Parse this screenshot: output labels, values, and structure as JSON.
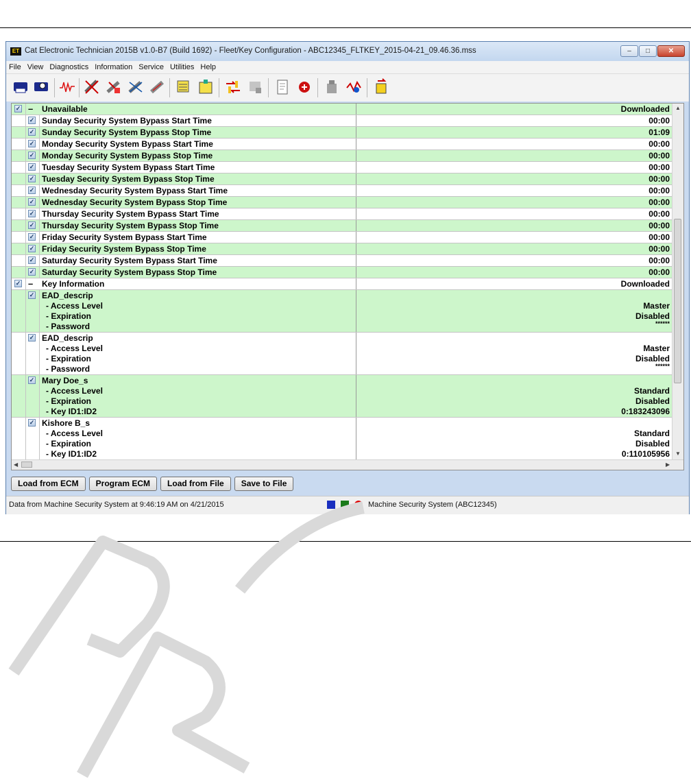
{
  "window": {
    "app_icon_text": "ET",
    "title": "Cat Electronic Technician 2015B v1.0-B7 (Build 1692) - Fleet/Key Configuration - ABC12345_FLTKEY_2015-04-21_09.46.36.mss",
    "controls": {
      "minimize": "–",
      "maximize": "□",
      "close": "✕"
    }
  },
  "menu": [
    "File",
    "View",
    "Diagnostics",
    "Information",
    "Service",
    "Utilities",
    "Help"
  ],
  "toolbar_icons": [
    "printer-icon",
    "print-preview-icon",
    "waveform-icon",
    "diagnostic-codes-icon",
    "logged-events-icon",
    "active-events-icon",
    "clear-events-icon",
    "status-groups-icon",
    "configuration-icon",
    "exchange-icon",
    "parameters-icon",
    "reports-icon",
    "ecm-connect-icon",
    "service-tool-icon",
    "flash-icon",
    "product-status-icon"
  ],
  "sections": [
    {
      "header": "Unavailable",
      "status": "Downloaded",
      "rows": [
        {
          "name": "Sunday Security System Bypass Start Time",
          "value": "00:00"
        },
        {
          "name": "Sunday Security System Bypass Stop Time",
          "value": "01:09"
        },
        {
          "name": "Monday Security System Bypass Start Time",
          "value": "00:00"
        },
        {
          "name": "Monday Security System Bypass Stop Time",
          "value": "00:00"
        },
        {
          "name": "Tuesday Security System Bypass Start Time",
          "value": "00:00"
        },
        {
          "name": "Tuesday Security System Bypass Stop Time",
          "value": "00:00"
        },
        {
          "name": "Wednesday Security System Bypass Start Time",
          "value": "00:00"
        },
        {
          "name": "Wednesday Security System Bypass Stop Time",
          "value": "00:00"
        },
        {
          "name": "Thursday Security System Bypass Start Time",
          "value": "00:00"
        },
        {
          "name": "Thursday Security System Bypass Stop Time",
          "value": "00:00"
        },
        {
          "name": "Friday Security System Bypass Start Time",
          "value": "00:00"
        },
        {
          "name": "Friday Security System Bypass Stop Time",
          "value": "00:00"
        },
        {
          "name": "Saturday Security System Bypass Start Time",
          "value": "00:00"
        },
        {
          "name": "Saturday Security System Bypass Stop Time",
          "value": "00:00"
        }
      ]
    },
    {
      "header": "Key Information",
      "status": "Downloaded",
      "keys": [
        {
          "name": "EAD_descrip",
          "fields": [
            "- Access Level",
            "- Expiration",
            "- Password"
          ],
          "values": [
            "Master",
            "Disabled",
            "******"
          ]
        },
        {
          "name": "EAD_descrip",
          "fields": [
            "- Access Level",
            "- Expiration",
            "- Password"
          ],
          "values": [
            "Master",
            "Disabled",
            "******"
          ]
        },
        {
          "name": "Mary Doe_s",
          "fields": [
            "- Access Level",
            "- Expiration",
            "- Key ID1:ID2"
          ],
          "values": [
            "Standard",
            "Disabled",
            "0:183243096"
          ]
        },
        {
          "name": "Kishore B_s",
          "fields": [
            "- Access Level",
            "- Expiration",
            "- Key ID1:ID2"
          ],
          "values": [
            "Standard",
            "Disabled",
            "0:110105956"
          ]
        }
      ]
    }
  ],
  "buttons": {
    "load_ecm": "Load from ECM",
    "program_ecm": "Program ECM",
    "load_file": "Load from File",
    "save_file": "Save to File"
  },
  "status": {
    "left": "Data from Machine Security System at 9:46:19 AM on 4/21/2015",
    "right": "Machine Security System (ABC12345)",
    "indicator_colors": [
      "#1a2fbf",
      "#1a7a1a",
      "#e00000"
    ]
  },
  "colors": {
    "row_green": "#cdf6cb",
    "row_white": "#ffffff",
    "watermark": "#d9d9d9"
  }
}
